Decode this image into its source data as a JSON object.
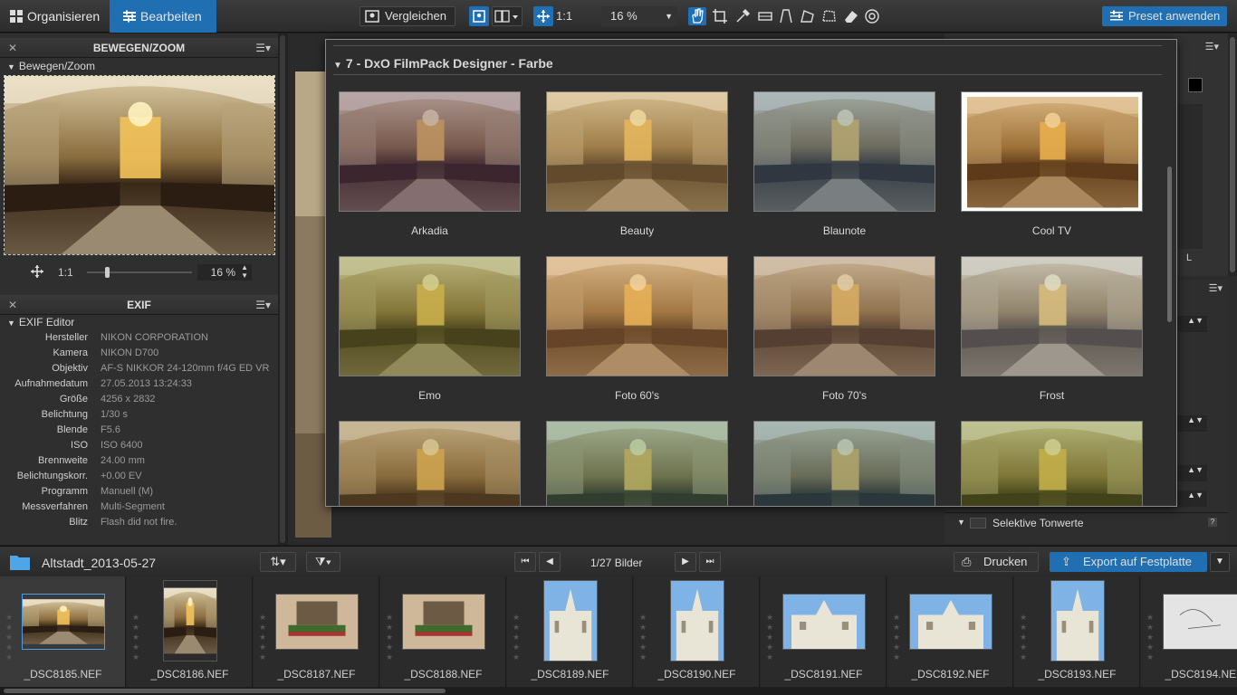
{
  "topbar": {
    "tab_organise": "Organisieren",
    "tab_edit": "Bearbeiten",
    "compare": "Vergleichen",
    "zoom_1to1": "1:1",
    "zoom_level": "16 %",
    "preset_apply": "Preset anwenden"
  },
  "left": {
    "move_zoom_title": "BEWEGEN/ZOOM",
    "move_zoom_sub": "Bewegen/Zoom",
    "nav_1to1": "1:1",
    "nav_zoom": "16 %",
    "exif_title": "EXIF",
    "exif_sub": "EXIF Editor",
    "exif_rows": [
      {
        "k": "Hersteller",
        "v": "NIKON CORPORATION"
      },
      {
        "k": "Kamera",
        "v": "NIKON D700"
      },
      {
        "k": "Objektiv",
        "v": "AF-S NIKKOR 24-120mm f/4G ED VR"
      },
      {
        "k": "Aufnahmedatum",
        "v": "27.05.2013 13:24:33"
      },
      {
        "k": "Größe",
        "v": "4256 x 2832"
      },
      {
        "k": "Belichtung",
        "v": "1/30 s"
      },
      {
        "k": "Blende",
        "v": "F5.6"
      },
      {
        "k": "ISO",
        "v": "ISO 6400"
      },
      {
        "k": "Brennweite",
        "v": "24.00 mm"
      },
      {
        "k": "Belichtungskorr.",
        "v": "+0.00 EV"
      },
      {
        "k": "Programm",
        "v": "Manuell (M)"
      },
      {
        "k": "Messverfahren",
        "v": "Multi-Segment"
      },
      {
        "k": "Blitz",
        "v": "Flash did not fire."
      }
    ]
  },
  "popup": {
    "category": "7 - DxO FilmPack Designer - Farbe",
    "presets": [
      "Arkadia",
      "Beauty",
      "Blaunote",
      "Cool TV",
      "Emo",
      "Foto 60's",
      "Foto 70's",
      "Frost"
    ]
  },
  "right": {
    "selective_tones": "Selektive Tonwerte",
    "histogram_channel": "L"
  },
  "browser": {
    "folder": "Altstadt_2013-05-27",
    "counter": "1/27 Bilder",
    "print": "Drucken",
    "export": "Export auf Festplatte"
  },
  "files": [
    "_DSC8185.NEF",
    "_DSC8186.NEF",
    "_DSC8187.NEF",
    "_DSC8188.NEF",
    "_DSC8189.NEF",
    "_DSC8190.NEF",
    "_DSC8191.NEF",
    "_DSC8192.NEF",
    "_DSC8193.NEF",
    "_DSC8194.NEF"
  ],
  "colors": {
    "accent": "#1f6fb2",
    "panel": "#2f2f2f",
    "background": "#1e1e1e"
  }
}
